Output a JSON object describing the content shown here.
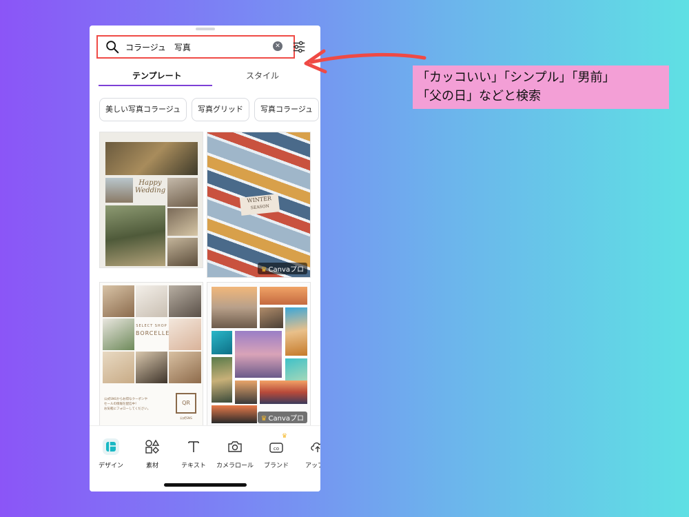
{
  "search": {
    "value": "コラージュ　写真"
  },
  "tabs": [
    {
      "label": "テンプレート",
      "active": true
    },
    {
      "label": "スタイル",
      "active": false
    }
  ],
  "chips": [
    "美しい写真コラージュ",
    "写真グリッド",
    "写真コラージュ"
  ],
  "templates": [
    {
      "text_lines": [
        "Happy",
        "Wedding"
      ],
      "pro": false
    },
    {
      "text_lines": [
        "WINTER",
        "SEASON"
      ],
      "badge": "Canvaプロ",
      "pro": true
    },
    {
      "text_lines": [
        "SELECT SHOP",
        "BORCELLE",
        "QR",
        "公式SNSからお得なクーポンや",
        "セールの情報を配信中！",
        "お気軽にフォローしてください。",
        "公式SNS"
      ],
      "pro": false
    },
    {
      "text_lines": [],
      "badge": "Canvaプロ",
      "pro": true
    }
  ],
  "bottom_nav": [
    {
      "label": "デザイン",
      "icon": "design-icon",
      "active": true
    },
    {
      "label": "素材",
      "icon": "elements-icon"
    },
    {
      "label": "テキスト",
      "icon": "text-icon"
    },
    {
      "label": "カメラロール",
      "icon": "camera-icon"
    },
    {
      "label": "ブランド",
      "icon": "brand-icon"
    },
    {
      "label": "アップロ",
      "icon": "upload-icon"
    }
  ],
  "callout": {
    "line1": "「カッコいい」「シンプル」「男前」",
    "line2": "「父の日」などと検索"
  },
  "colors": {
    "highlight": "#ef4a45",
    "accent": "#7d3fd6",
    "callout_bg": "#f39fd6",
    "brand_teal": "#19b8c4"
  }
}
